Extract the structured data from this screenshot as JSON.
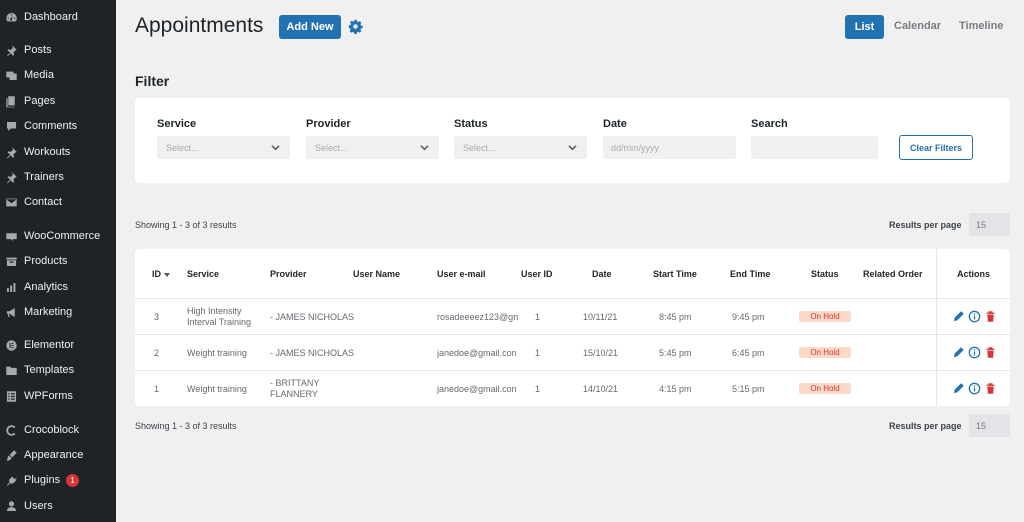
{
  "sidebar": {
    "items": [
      {
        "label": "Dashboard",
        "icon": "dashboard-icon"
      },
      {
        "label": "Posts",
        "icon": "pin-icon"
      },
      {
        "label": "Media",
        "icon": "media-icon"
      },
      {
        "label": "Pages",
        "icon": "pages-icon"
      },
      {
        "label": "Comments",
        "icon": "comment-icon"
      },
      {
        "label": "Workouts",
        "icon": "pin-icon"
      },
      {
        "label": "Trainers",
        "icon": "pin-icon"
      },
      {
        "label": "Contact",
        "icon": "mail-icon"
      },
      {
        "label": "WooCommerce",
        "icon": "woo-icon"
      },
      {
        "label": "Products",
        "icon": "products-icon"
      },
      {
        "label": "Analytics",
        "icon": "analytics-icon"
      },
      {
        "label": "Marketing",
        "icon": "megaphone-icon"
      },
      {
        "label": "Elementor",
        "icon": "elementor-icon"
      },
      {
        "label": "Templates",
        "icon": "folder-icon"
      },
      {
        "label": "WPForms",
        "icon": "forms-icon"
      },
      {
        "label": "Crocoblock",
        "icon": "crocoblock-icon"
      },
      {
        "label": "Appearance",
        "icon": "brush-icon"
      },
      {
        "label": "Plugins",
        "icon": "plugin-icon",
        "badge": "1"
      },
      {
        "label": "Users",
        "icon": "user-icon"
      }
    ]
  },
  "header": {
    "title": "Appointments",
    "add_new_label": "Add New",
    "views": {
      "list": "List",
      "calendar": "Calendar",
      "timeline": "Timeline"
    }
  },
  "filter": {
    "title": "Filter",
    "service_label": "Service",
    "service_placeholder": "Select...",
    "provider_label": "Provider",
    "provider_placeholder": "Select...",
    "status_label": "Status",
    "status_placeholder": "Select...",
    "date_label": "Date",
    "date_placeholder": "dd/mm/yyyy",
    "search_label": "Search",
    "clear_label": "Clear Filters"
  },
  "results": {
    "showing_text": "Showing 1 - 3 of 3 results",
    "per_page_label": "Results per page",
    "per_page_value": "15"
  },
  "table": {
    "columns": {
      "id": "ID",
      "service": "Service",
      "provider": "Provider",
      "user_name": "User Name",
      "user_email": "User e-mail",
      "user_id": "User ID",
      "date": "Date",
      "start_time": "Start Time",
      "end_time": "End Time",
      "status": "Status",
      "related_order": "Related Order",
      "actions": "Actions"
    },
    "rows": [
      {
        "id": "3",
        "service": "High Intensity Interval Training",
        "provider": "- JAMES NICHOLAS",
        "user_name": "",
        "user_email": "rosadeeeez123@gn",
        "user_id": "1",
        "date": "10/11/21",
        "start_time": "8:45 pm",
        "end_time": "9:45 pm",
        "status": "On Hold",
        "related_order": ""
      },
      {
        "id": "2",
        "service": "Weight training",
        "provider": "- JAMES NICHOLAS",
        "user_name": "",
        "user_email": "janedoe@gmail.con",
        "user_id": "1",
        "date": "15/10/21",
        "start_time": "5:45 pm",
        "end_time": "6:45 pm",
        "status": "On Hold",
        "related_order": ""
      },
      {
        "id": "1",
        "service": "Weight training",
        "provider": "- BRITTANY FLANNERY",
        "user_name": "",
        "user_email": "janedoe@gmail.con",
        "user_id": "1",
        "date": "14/10/21",
        "start_time": "4:15 pm",
        "end_time": "5:15 pm",
        "status": "On Hold",
        "related_order": ""
      }
    ]
  },
  "colors": {
    "sidebar_bg": "#1d2327",
    "accent": "#2271b1",
    "status_bg": "#fbd9c9",
    "delete": "#d63638"
  }
}
